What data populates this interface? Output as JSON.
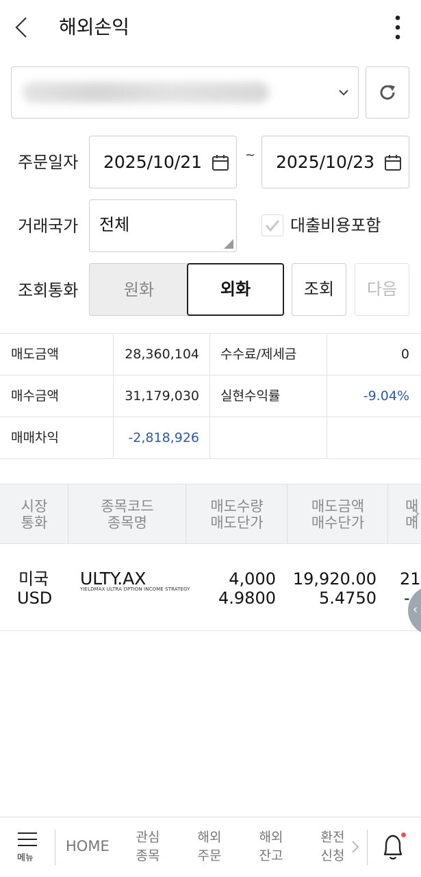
{
  "header": {
    "title": "해외손익"
  },
  "filters": {
    "order_date_label": "주문일자",
    "start_date": "2025/10/21",
    "date_separator": "~",
    "end_date": "2025/10/23",
    "country_label": "거래국가",
    "country_value": "전체",
    "loan_cost_label": "대출비용포함",
    "loan_cost_checked": true,
    "currency_label": "조회통화",
    "currency_krw": "원화",
    "currency_foreign": "외화",
    "currency_selected": "외화",
    "query_button": "조회",
    "next_button": "다음"
  },
  "summary": {
    "sell_amount_label": "매도금액",
    "sell_amount": "28,360,104",
    "fee_tax_label": "수수료/제세금",
    "fee_tax": "0",
    "buy_amount_label": "매수금액",
    "buy_amount": "31,179,030",
    "realized_rate_label": "실현수익률",
    "realized_rate": "-9.04%",
    "trade_pl_label": "매매차익",
    "trade_pl": "-2,818,926"
  },
  "grid": {
    "headers": [
      {
        "line1": "시장",
        "line2": "통화"
      },
      {
        "line1": "종목코드",
        "line2": "종목명"
      },
      {
        "line1": "매도수량",
        "line2": "매도단가"
      },
      {
        "line1": "매도금액",
        "line2": "매수단가"
      },
      {
        "line1": "매",
        "line2": "매"
      }
    ],
    "rows": [
      {
        "market": "미국",
        "currency": "USD",
        "code": "ULTY.AX",
        "name": "YIELDMAX ULTRA OPTION INCOME STRATEGY",
        "sell_qty": "4,000",
        "sell_price": "4.9800",
        "sell_amount": "19,920.00",
        "buy_price": "5.4750",
        "next_col_line1": "21",
        "next_col_line2": "-"
      }
    ]
  },
  "bottom_nav": {
    "menu_label": "메뉴",
    "home": "HOME",
    "items": [
      {
        "line1": "관심",
        "line2": "종목"
      },
      {
        "line1": "해외",
        "line2": "주문"
      },
      {
        "line1": "해외",
        "line2": "잔고"
      },
      {
        "line1": "환전",
        "line2": "신청"
      }
    ]
  },
  "colors": {
    "negative": "#2d5aa0",
    "notification_dot": "#e9534d"
  }
}
